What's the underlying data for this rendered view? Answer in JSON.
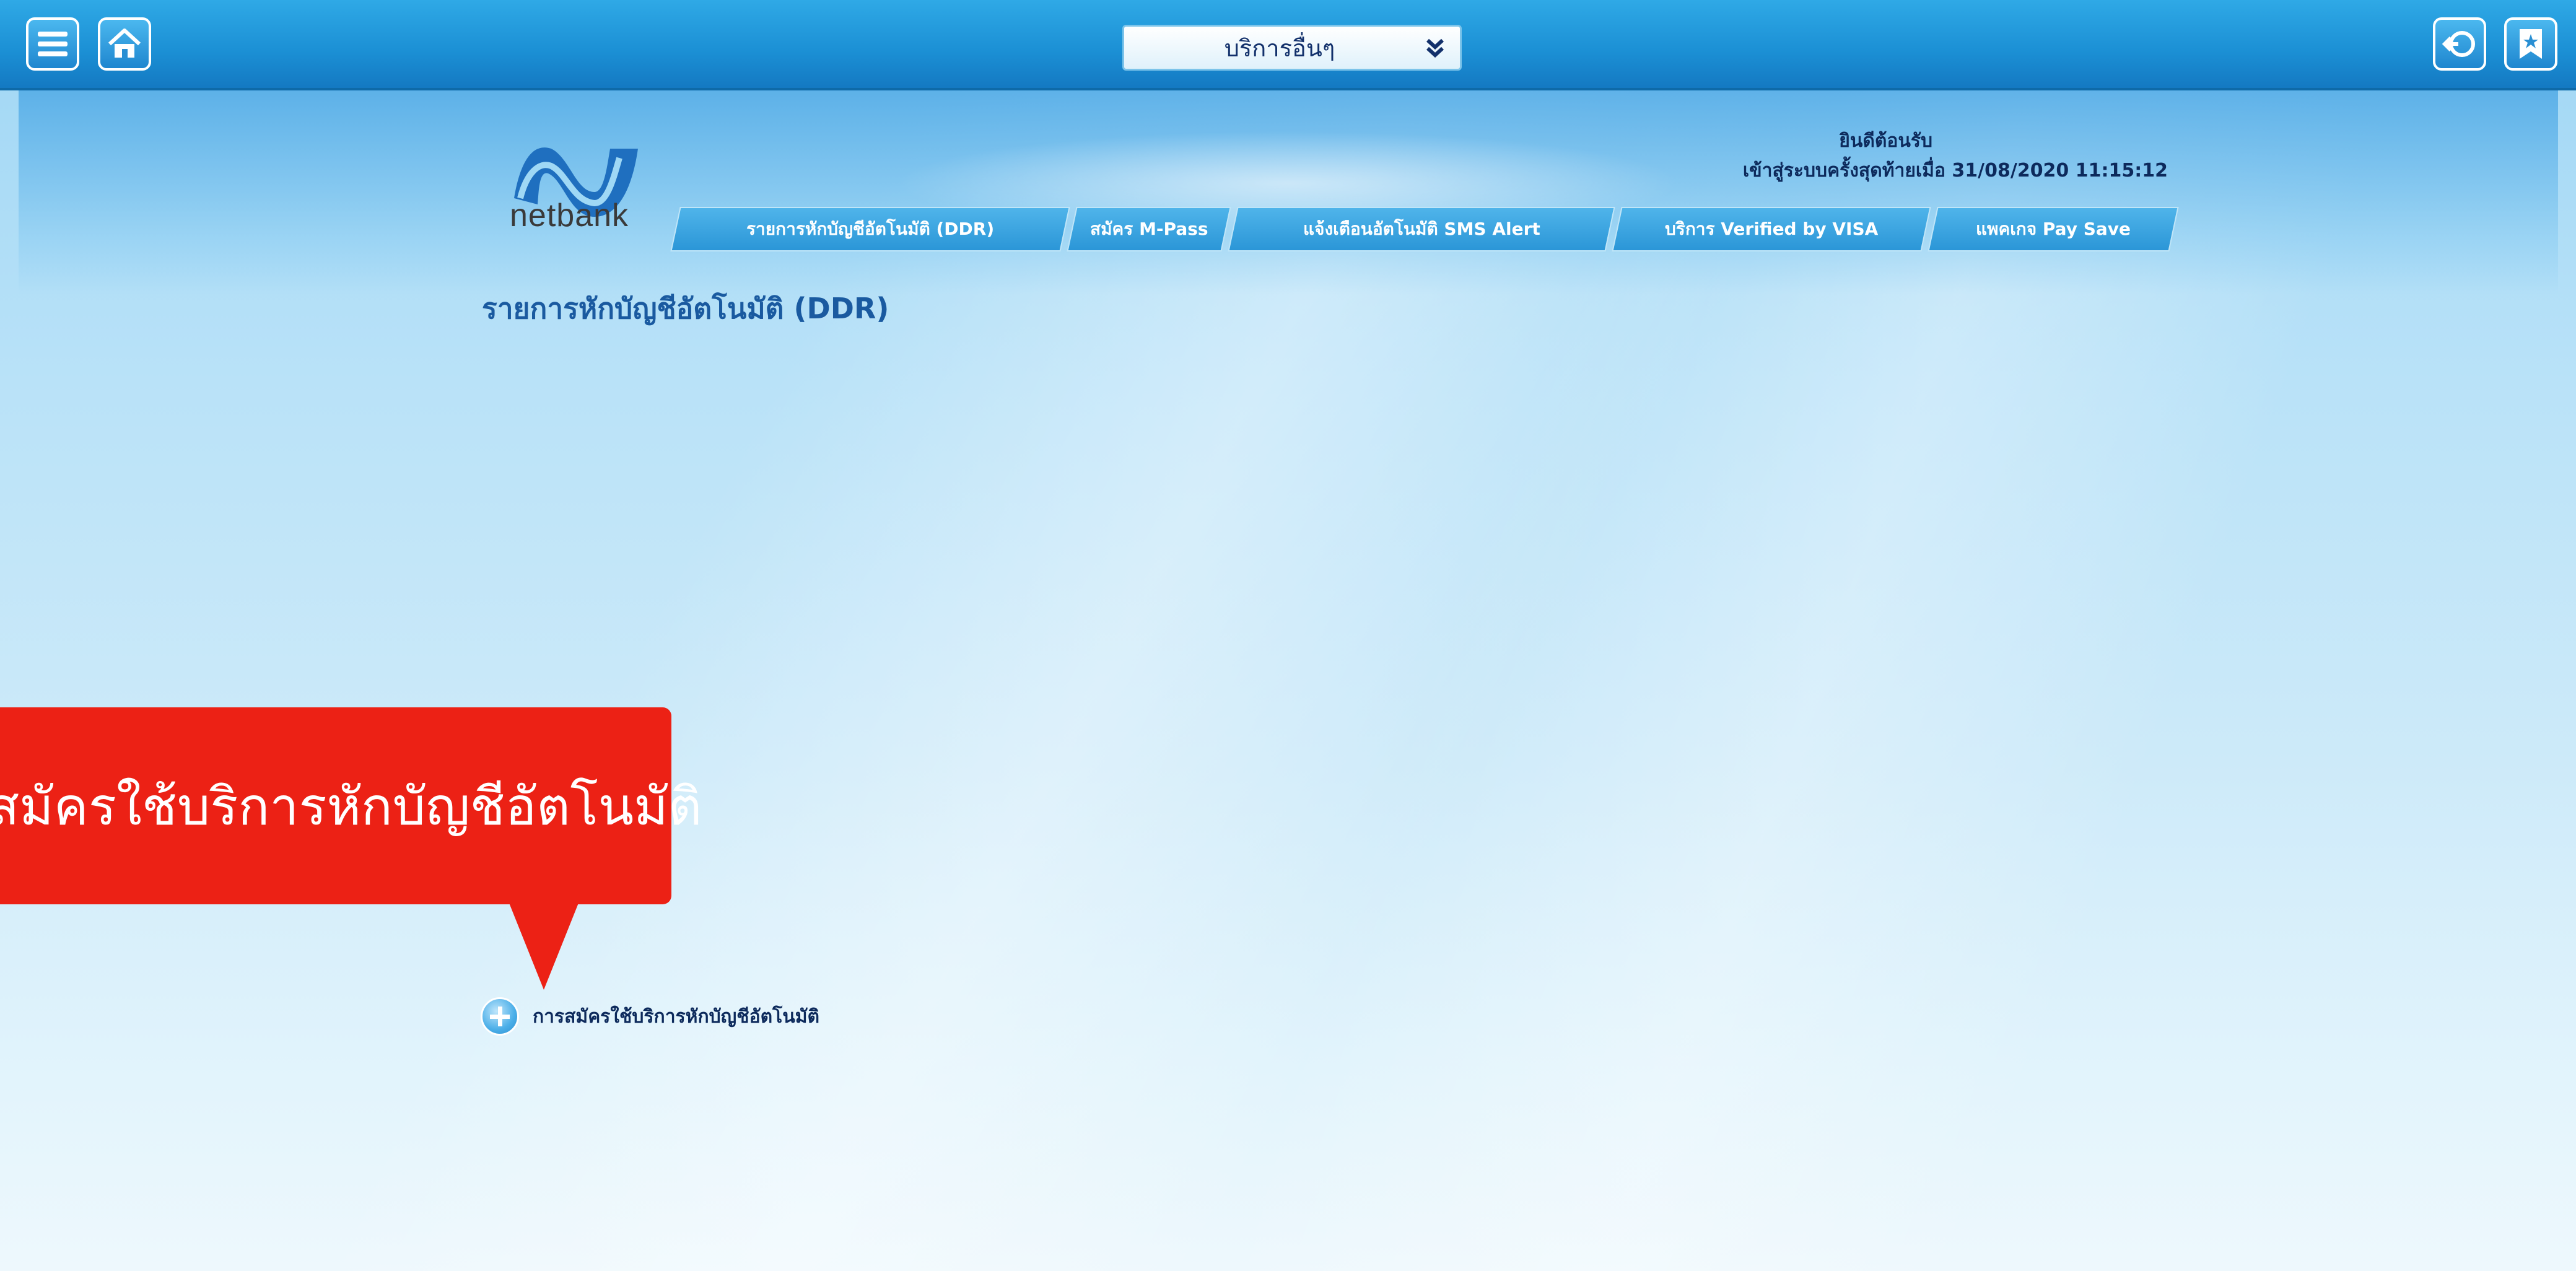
{
  "topbar": {
    "menu_icon": "hamburger-menu-icon",
    "home_icon": "home-icon",
    "service_select": {
      "selected": "บริการอื่นๆ",
      "icon": "double-chevron-down-icon"
    },
    "logout_icon": "logout-icon",
    "favorite_icon": "bookmark-star-icon"
  },
  "header": {
    "logo_text": "netbank",
    "welcome_line1": "ยินดีต้อนรับ",
    "welcome_line2": "เข้าสู่ระบบครั้งสุดท้ายเมื่อ 31/08/2020 11:15:12"
  },
  "tabs": [
    {
      "label": "รายการหักบัญชีอัตโนมัติ (DDR)"
    },
    {
      "label": "สมัคร M-Pass"
    },
    {
      "label": "แจ้งเตือนอัตโนมัติ SMS Alert"
    },
    {
      "label": "บริการ Verified by VISA"
    },
    {
      "label": "แพคเกจ Pay Save"
    }
  ],
  "main": {
    "page_title": "รายการหักบัญชีอัตโนมัติ (DDR)",
    "apply_link": "การสมัครใช้บริการหักบัญชีอัตโนมัติ"
  },
  "callout": {
    "text": "สมัครใช้บริการหักบัญชีอัตโนมัติ"
  },
  "colors": {
    "topbar": "#1b8fd4",
    "callout": "#ec2115",
    "title": "#1a5aa0"
  }
}
